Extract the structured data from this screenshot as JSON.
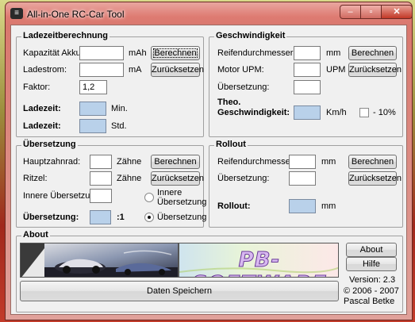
{
  "window": {
    "title": "All-in-One RC-Car Tool",
    "icon_glyph": "≡"
  },
  "controls": {
    "minimize": "–",
    "maximize": "▫",
    "close": "✕"
  },
  "ladezeit": {
    "title": "Ladezeitberechnung",
    "kapazitaet_label": "Kapazität Akku:",
    "kapazitaet_value": "",
    "kapazitaet_unit": "mAh",
    "ladestrom_label": "Ladestrom:",
    "ladestrom_value": "",
    "ladestrom_unit": "mA",
    "faktor_label": "Faktor:",
    "faktor_value": "1,2",
    "ladezeit_min_label": "Ladezeit:",
    "ladezeit_min_value": "",
    "ladezeit_min_unit": "Min.",
    "ladezeit_std_label": "Ladezeit:",
    "ladezeit_std_value": "",
    "ladezeit_std_unit": "Std.",
    "berechnen": "Berechnen",
    "zuruecksetzen": "Zurücksetzen"
  },
  "geschwindigkeit": {
    "title": "Geschwindigkeit",
    "reifen_label": "Reifendurchmesser:",
    "reifen_value": "",
    "reifen_unit": "mm",
    "motor_label": "Motor UPM:",
    "motor_value": "",
    "motor_unit": "UPM",
    "uebersetzung_label": "Übersetzung:",
    "uebersetzung_value": "",
    "theo_label_1": "Theo.",
    "theo_label_2": "Geschwindigkeit:",
    "theo_value": "",
    "theo_unit": "Km/h",
    "minus10_label": "- 10%",
    "minus10_checked": false,
    "berechnen": "Berechnen",
    "zuruecksetzen": "Zurücksetzen"
  },
  "uebersetzung": {
    "title": "Übersetzung",
    "haupt_label": "Hauptzahnrad:",
    "haupt_value": "",
    "haupt_unit": "Zähne",
    "ritzel_label": "Ritzel:",
    "ritzel_value": "",
    "ritzel_unit": "Zähne",
    "innere_label": "Innere Übersetzung:",
    "innere_value": "",
    "result_label": "Übersetzung:",
    "result_value": "",
    "result_unit": ":1",
    "radio_innere_1": "Innere",
    "radio_innere_2": "Übersetzung",
    "radio_uebersetzung": "Übersetzung",
    "selected_radio": "Übersetzung",
    "berechnen": "Berechnen",
    "zuruecksetzen": "Zurücksetzen"
  },
  "rollout": {
    "title": "Rollout",
    "reifen_label": "Reifendurchmesser:",
    "reifen_value": "",
    "reifen_unit": "mm",
    "uebersetzung_label": "Übersetzung:",
    "uebersetzung_value": "",
    "result_label": "Rollout:",
    "result_value": "",
    "result_unit": "mm",
    "berechnen": "Berechnen",
    "zuruecksetzen": "Zurücksetzen"
  },
  "about": {
    "title": "About",
    "logo_text": "PB-SOFTWARE",
    "save_button": "Daten Speichern",
    "about_button": "About",
    "hilfe_button": "Hilfe",
    "version": "Version: 2.3",
    "copyright": "© 2006 - 2007",
    "author": "Pascal Betke"
  },
  "colors": {
    "output_field": "#b9d1ea",
    "title_bar": "#de7b72",
    "dialog": "#f0f0f0"
  }
}
